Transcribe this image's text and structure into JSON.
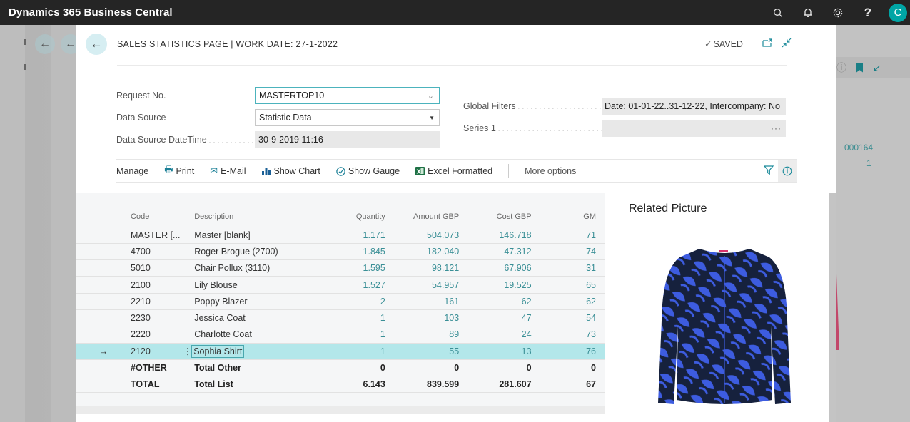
{
  "app": {
    "title": "Dynamics 365 Business Central",
    "toolbar_icons": [
      "search-icon",
      "bell-icon",
      "gear-icon",
      "help-icon"
    ],
    "help_glyph": "?",
    "avatar_initial": "C",
    "accent_color": "#00a5a5"
  },
  "background": {
    "side_values": [
      "000164",
      "1"
    ]
  },
  "dialog": {
    "title": "SALES STATISTICS PAGE | WORK DATE: 27-1-2022",
    "saved_label": "SAVED",
    "fields_left": [
      {
        "label": "Request No.",
        "value": "MASTERTOP10"
      },
      {
        "label": "Data Source",
        "value": "Statistic Data"
      },
      {
        "label": "Data Source DateTime",
        "value": "30-9-2019 11:16"
      }
    ],
    "fields_right": [
      {
        "label": "Global Filters",
        "value": "Date: 01-01-22..31-12-22, Intercompany: No"
      },
      {
        "label": "Series 1",
        "value": ""
      }
    ],
    "actions": {
      "manage": "Manage",
      "print": "Print",
      "email": "E-Mail",
      "show_chart": "Show Chart",
      "show_gauge": "Show Gauge",
      "excel": "Excel Formatted",
      "more": "More options"
    },
    "grid": {
      "columns": [
        "Code",
        "Description",
        "Quantity",
        "Amount GBP",
        "Cost GBP",
        "GM"
      ],
      "rows": [
        {
          "code": "MASTER [...",
          "description": "Master [blank]",
          "quantity": "1.171",
          "amount": "504.073",
          "cost": "146.718",
          "gm": "71"
        },
        {
          "code": "4700",
          "description": "Roger Brogue (2700)",
          "quantity": "1.845",
          "amount": "182.040",
          "cost": "47.312",
          "gm": "74"
        },
        {
          "code": "5010",
          "description": "Chair Pollux (3110)",
          "quantity": "1.595",
          "amount": "98.121",
          "cost": "67.906",
          "gm": "31"
        },
        {
          "code": "2100",
          "description": "Lily Blouse",
          "quantity": "1.527",
          "amount": "54.957",
          "cost": "19.525",
          "gm": "65"
        },
        {
          "code": "2210",
          "description": "Poppy Blazer",
          "quantity": "2",
          "amount": "161",
          "cost": "62",
          "gm": "62"
        },
        {
          "code": "2230",
          "description": "Jessica Coat",
          "quantity": "1",
          "amount": "103",
          "cost": "47",
          "gm": "54"
        },
        {
          "code": "2220",
          "description": "Charlotte Coat",
          "quantity": "1",
          "amount": "89",
          "cost": "24",
          "gm": "73"
        },
        {
          "code": "2120",
          "description": "Sophia Shirt",
          "quantity": "1",
          "amount": "55",
          "cost": "13",
          "gm": "76",
          "selected": true
        },
        {
          "code": "#OTHER",
          "description": "Total Other",
          "quantity": "0",
          "amount": "0",
          "cost": "0",
          "gm": "0",
          "bold": true
        },
        {
          "code": "TOTAL",
          "description": "Total List",
          "quantity": "6.143",
          "amount": "839.599",
          "cost": "281.607",
          "gm": "67",
          "bold": true
        }
      ]
    },
    "related_picture": {
      "title": "Related Picture",
      "subject": "blue leaf-print long-sleeve shirt"
    }
  }
}
